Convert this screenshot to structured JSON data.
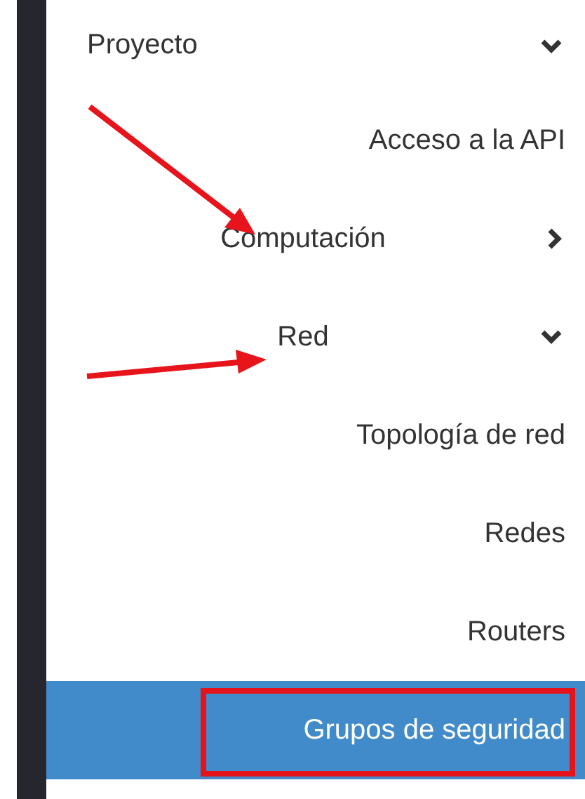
{
  "sidebar": {
    "items": [
      {
        "kind": "section",
        "label": "Proyecto",
        "expanded": true,
        "children": [
          {
            "kind": "link",
            "label": "Acceso a la API",
            "selected": false,
            "annotated": false
          },
          {
            "kind": "group",
            "label": "Computación",
            "expanded": false
          },
          {
            "kind": "group",
            "label": "Red",
            "expanded": true,
            "children": [
              {
                "kind": "link",
                "label": "Topología de red",
                "selected": false,
                "annotated": false
              },
              {
                "kind": "link",
                "label": "Redes",
                "selected": false,
                "annotated": false
              },
              {
                "kind": "link",
                "label": "Routers",
                "selected": false,
                "annotated": false
              },
              {
                "kind": "link",
                "label": "Grupos de seguridad",
                "selected": true,
                "annotated": true
              }
            ]
          }
        ]
      }
    ]
  }
}
